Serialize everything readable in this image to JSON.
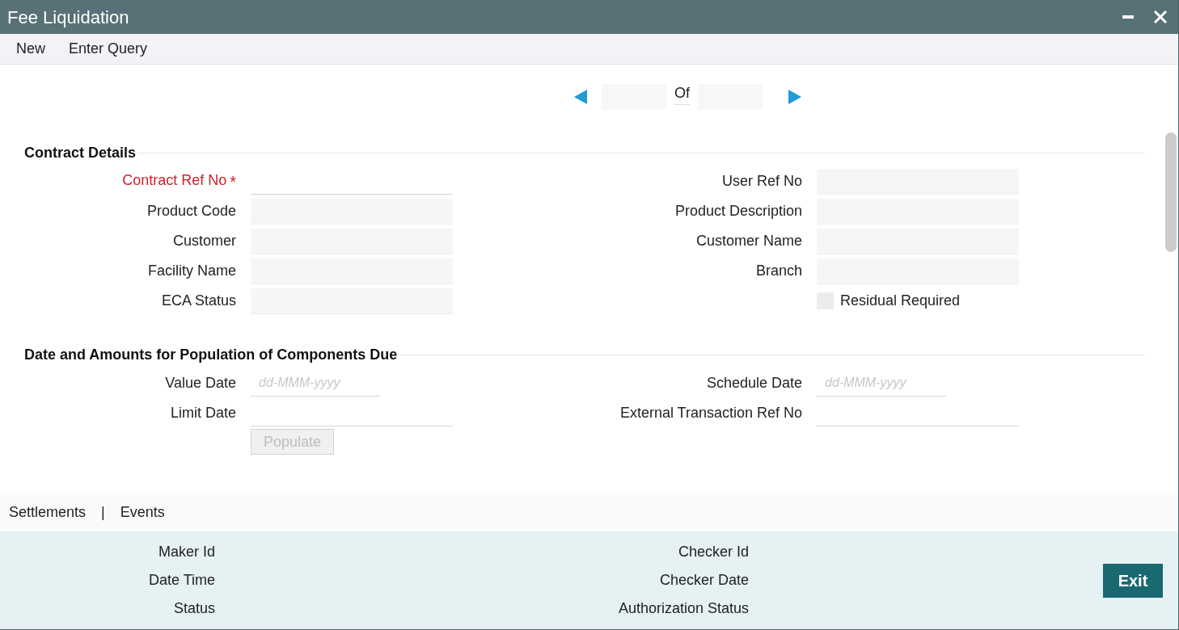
{
  "window": {
    "title": "Fee Liquidation"
  },
  "menu": [
    "New",
    "Enter Query"
  ],
  "pager": {
    "separator": "Of"
  },
  "sections": [
    {
      "title": "Contract Details",
      "rows": [
        {
          "left": {
            "label": "Contract Ref No",
            "kind": "input",
            "required": true,
            "required_mark": "*"
          },
          "right": {
            "label": "User Ref No",
            "kind": "readonly"
          }
        },
        {
          "left": {
            "label": "Product Code",
            "kind": "readonly"
          },
          "right": {
            "label": "Product Description",
            "kind": "readonly"
          }
        },
        {
          "left": {
            "label": "Customer",
            "kind": "readonly"
          },
          "right": {
            "label": "Customer Name",
            "kind": "readonly"
          }
        },
        {
          "left": {
            "label": "Facility Name",
            "kind": "readonly"
          },
          "right": {
            "label": "Branch",
            "kind": "readonly"
          }
        },
        {
          "left": {
            "label": "ECA Status",
            "kind": "readonly"
          },
          "right": {
            "label": "Residual Required",
            "kind": "checkbox",
            "checked": false
          }
        }
      ]
    },
    {
      "title": "Date and Amounts for Population of Components Due",
      "rows": [
        {
          "left": {
            "label": "Value Date",
            "kind": "date",
            "placeholder": "dd-MMM-yyyy"
          },
          "right": {
            "label": "Schedule Date",
            "kind": "date",
            "placeholder": "dd-MMM-yyyy"
          }
        },
        {
          "left": {
            "label": "Limit Date",
            "kind": "input"
          },
          "right": {
            "label": "External Transaction Ref No",
            "kind": "input"
          }
        }
      ],
      "button": {
        "label": "Populate",
        "disabled": true
      }
    }
  ],
  "footer_tabs": {
    "items": [
      "Settlements",
      "Events"
    ],
    "separator": "|"
  },
  "audit": {
    "left": [
      "Maker Id",
      "Date Time",
      "Status"
    ],
    "right": [
      "Checker Id",
      "Checker Date",
      "Authorization Status"
    ]
  },
  "exit_button": "Exit"
}
